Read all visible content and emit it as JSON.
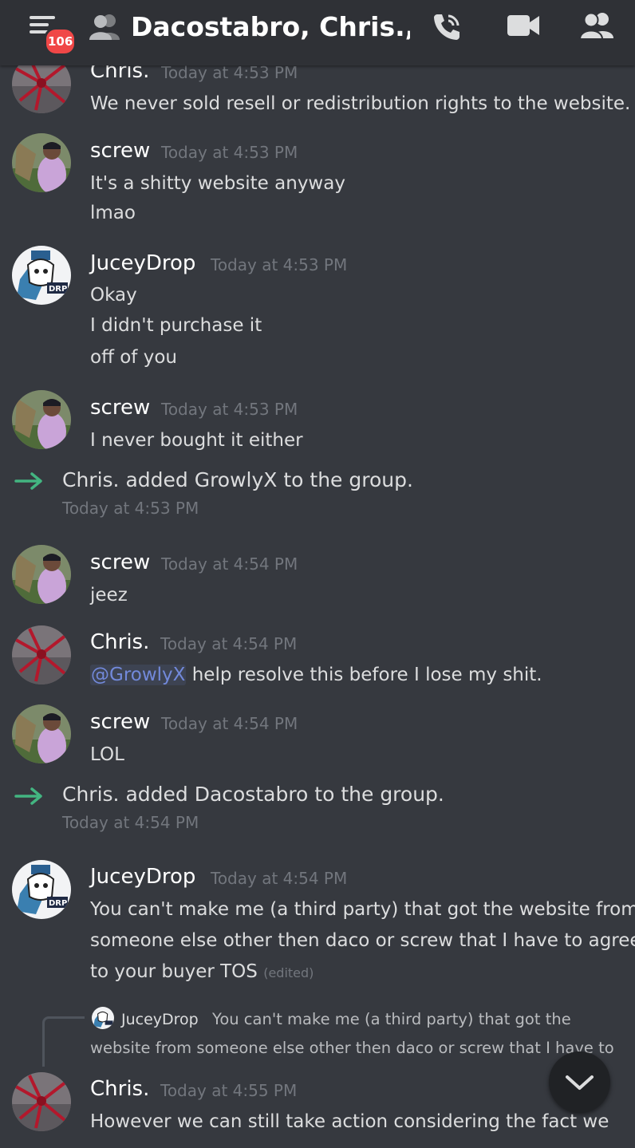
{
  "header": {
    "badge": "106",
    "title": "Dacostabro, Chris.,...",
    "icons": [
      "menu-icon",
      "group-people-icon",
      "voice-call-icon",
      "video-call-icon",
      "members-icon"
    ]
  },
  "messages": [
    {
      "author": "Chris.",
      "time": "Today at 4:53 PM",
      "avatar": "chris-avatar",
      "lines": [
        "We never sold resell or redistribution rights to the website."
      ]
    },
    {
      "author": "screw",
      "time": "Today at 4:53 PM",
      "avatar": "screw-avatar",
      "lines": [
        "It's a shitty website anyway",
        "lmao"
      ]
    },
    {
      "author": "JuceyDrop",
      "time": "Today at 4:53 PM",
      "avatar": "juceydrop-avatar",
      "lines": [
        "Okay",
        "I didn't purchase it",
        "off of you"
      ]
    },
    {
      "author": "screw",
      "time": "Today at 4:53 PM",
      "avatar": "screw-avatar",
      "lines": [
        "I never bought it either"
      ]
    },
    {
      "author": "screw",
      "time": "Today at 4:54 PM",
      "avatar": "screw-avatar",
      "lines": [
        "jeez"
      ]
    },
    {
      "author": "Chris.",
      "time": "Today at 4:54 PM",
      "avatar": "chris-avatar",
      "mention": "@GrowlyX",
      "lines": [
        " help resolve this before I lose my shit."
      ]
    },
    {
      "author": "screw",
      "time": "Today at 4:54 PM",
      "avatar": "screw-avatar",
      "lines": [
        "LOL"
      ]
    },
    {
      "author": "JuceyDrop",
      "time": "Today at 4:54 PM",
      "avatar": "juceydrop-avatar",
      "lines": [
        "You can't make me (a third party) that got the website from",
        "someone else other then daco or screw that I have to agree",
        "to your buyer TOS"
      ],
      "edited": "(edited)"
    },
    {
      "author": "Chris.",
      "time": "Today at 4:55 PM",
      "avatar": "chris-avatar",
      "lines": [
        "However we can still take action considering the fact we"
      ]
    }
  ],
  "system": [
    {
      "text": "Chris. added GrowlyX to the group.",
      "time": "Today at 4:53 PM",
      "icon": "join-arrow-icon"
    },
    {
      "text": "Chris. added Dacostabro to the group.",
      "time": "Today at 4:54 PM",
      "icon": "join-arrow-icon"
    }
  ],
  "reply": {
    "author": "JuceyDrop",
    "lines": [
      "You can't make me (a third party) that got the",
      "website from someone else other then daco or screw that I have to"
    ]
  },
  "scroll_button": {
    "icon": "chevron-down-icon"
  },
  "colors": {
    "background": "#36393f",
    "header": "#2f3136",
    "badge": "#f04747",
    "mention": "#7289da",
    "join_arrow": "#43b581",
    "timestamp": "#72767d"
  }
}
